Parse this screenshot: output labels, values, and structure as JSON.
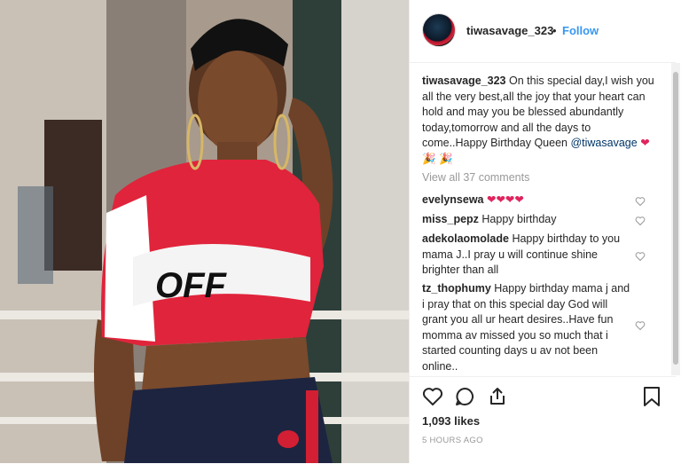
{
  "post": {
    "username": "tiwasavage_323",
    "dot": "•",
    "follow_label": "Follow",
    "caption_user": "tiwasavage_323",
    "caption_text": "On this special day,I wish you all the very best,all the joy that your heart can hold and may you be blessed abundantly today,tomorrow and all the days to come..Happy Birthday Queen",
    "caption_mention": "@tiwasavage",
    "view_all": "View all 37 comments",
    "likes": "1,093 likes",
    "time": "5 HOURS AGO",
    "photo_text": "OFF"
  },
  "comments": [
    {
      "user": "evelynsewa",
      "text": ""
    },
    {
      "user": "miss_pepz",
      "text": "Happy birthday"
    },
    {
      "user": "adekolaomolade",
      "text": "Happy birthday to you mama J..I pray u will continue shine brighter than all"
    },
    {
      "user": "tz_thophumy",
      "text": "Happy birthday mama j and i pray that on this special day God will grant you all ur heart desires..Have fun momma av missed you so much that i started counting days u av not been online.."
    }
  ],
  "colors": {
    "link_blue": "#3897f0",
    "mention": "#003569",
    "muted": "#999999",
    "text": "#262626",
    "heart_red": "#e0245e"
  },
  "icons": [
    "heart-icon",
    "comment-icon",
    "share-icon",
    "bookmark-icon",
    "like-comment-icon"
  ]
}
